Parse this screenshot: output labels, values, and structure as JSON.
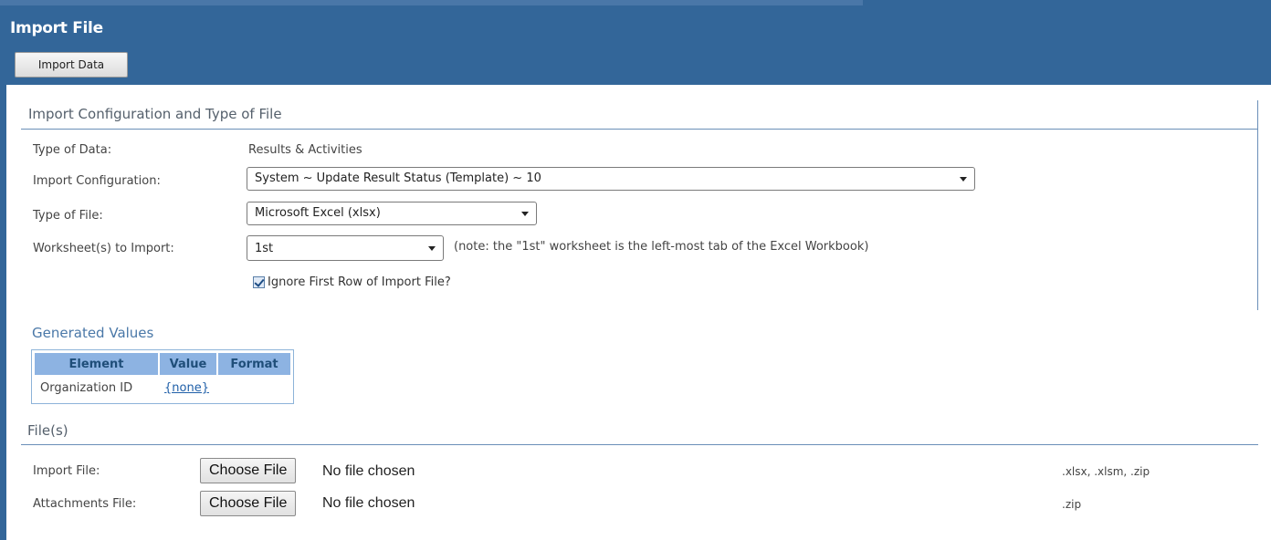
{
  "window": {
    "title": "Import File"
  },
  "toolbar": {
    "import_data_label": "Import Data"
  },
  "config_section": {
    "header": "Import Configuration and Type of File",
    "type_of_data": {
      "label": "Type of Data:",
      "value": "Results & Activities"
    },
    "import_configuration": {
      "label": "Import Configuration:",
      "selected": "System ~ Update Result Status (Template) ~ 10"
    },
    "type_of_file": {
      "label": "Type of File:",
      "selected": "Microsoft Excel (xlsx)"
    },
    "worksheets": {
      "label": "Worksheet(s) to Import:",
      "selected": "1st",
      "note": "(note: the \"1st\" worksheet is the left-most tab of the Excel Workbook)"
    },
    "ignore_first_row": {
      "label": "Ignore First Row of Import File?",
      "checked": true
    }
  },
  "generated_values": {
    "header": "Generated Values",
    "columns": [
      "Element",
      "Value",
      "Format"
    ],
    "rows": [
      {
        "element": "Organization ID",
        "value": "{none}",
        "format": ""
      }
    ]
  },
  "files_section": {
    "header": "File(s)",
    "import_file": {
      "label": "Import File:",
      "button": "Choose File",
      "status": "No file chosen",
      "extensions": ".xlsx, .xlsm, .zip"
    },
    "attachments_file": {
      "label": "Attachments File:",
      "button": "Choose File",
      "status": "No file chosen",
      "extensions": ".zip"
    }
  },
  "colors": {
    "header_bg": "#336699",
    "table_header_bg": "#8db3e2",
    "link": "#1f5fa8"
  }
}
